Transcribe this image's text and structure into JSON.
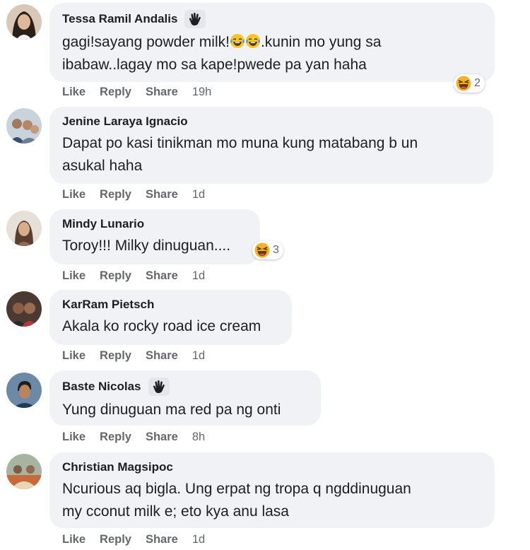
{
  "comments": [
    {
      "name": "Tessa Ramil Andalis",
      "text_part1": "gagi!sayang powder milk!",
      "text_part2": ".kunin mo yung sa",
      "text_line2": "ibabaw..lagay mo sa kape!pwede pa yan haha",
      "like": "Like",
      "reply": "Reply",
      "share": "Share",
      "time": "19h",
      "reaction_count": "2"
    },
    {
      "name": "Jenine Laraya Ignacio",
      "text_line1": "Dapat po kasi tinikman mo muna kung matabang b un",
      "text_line2": "asukal haha",
      "like": "Like",
      "reply": "Reply",
      "share": "Share",
      "time": "1d"
    },
    {
      "name": "Mindy Lunario",
      "text_line1": "Toroy!!! Milky dinuguan....",
      "like": "Like",
      "reply": "Reply",
      "share": "Share",
      "time": "1d",
      "reaction_count": "3"
    },
    {
      "name": "KarRam Pietsch",
      "text_line1": "Akala ko rocky road ice cream",
      "like": "Like",
      "reply": "Reply",
      "share": "Share",
      "time": "1d"
    },
    {
      "name": "Baste Nicolas",
      "text_line1": "Yung dinuguan ma red pa ng onti",
      "like": "Like",
      "reply": "Reply",
      "share": "Share",
      "time": "8h"
    },
    {
      "name": "Christian Magsipoc",
      "text_line1": "Ncurious aq bigla. Ung erpat ng tropa q ngddinuguan",
      "text_line2": "my cconut milk e; eto kya anu lasa",
      "like": "Like",
      "reply": "Reply",
      "share": "Share",
      "time": "1d"
    }
  ]
}
